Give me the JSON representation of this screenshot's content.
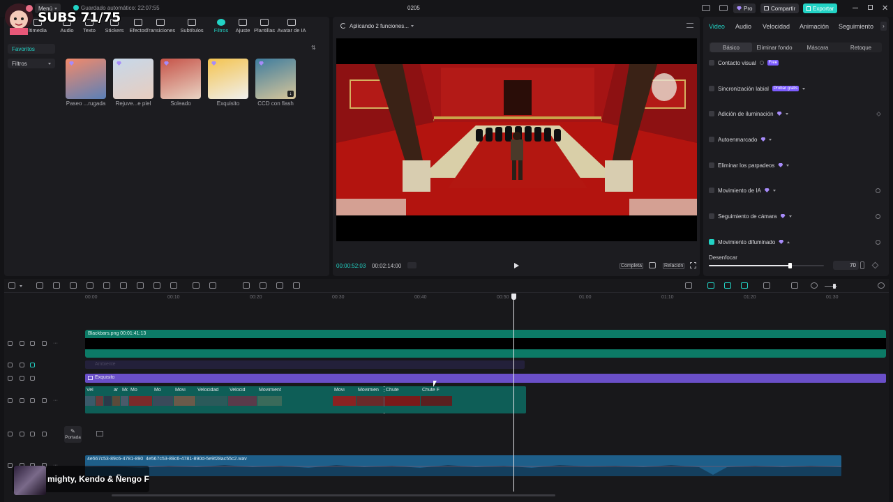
{
  "topbar": {
    "menu_label": "Menú",
    "autosave_label": "Guardado automático: 22:07:55",
    "project_title": "0205",
    "pro_label": "Pro",
    "share_label": "Compartir",
    "export_label": "Exportar"
  },
  "overlay": {
    "subs_text": "SUBS 71/75"
  },
  "toolbar": {
    "items": [
      {
        "label": "ltimedia",
        "icon": "media-icon"
      },
      {
        "label": "Audio",
        "icon": "audio-icon"
      },
      {
        "label": "Texto",
        "icon": "text-icon"
      },
      {
        "label": "Stickers",
        "icon": "sticker-icon"
      },
      {
        "label": "Efectos",
        "icon": "effects-icon"
      },
      {
        "label": "Transiciones",
        "icon": "transitions-icon"
      },
      {
        "label": "Subtítulos",
        "icon": "subtitles-icon"
      },
      {
        "label": "Filtros",
        "icon": "filters-icon"
      },
      {
        "label": "Ajuste",
        "icon": "adjust-icon"
      },
      {
        "label": "Plantillas",
        "icon": "templates-icon"
      },
      {
        "label": "Avatar de IA",
        "icon": "ai-avatar-icon"
      }
    ]
  },
  "sidebar": {
    "favorites": "Favoritos",
    "filters": "Filtros"
  },
  "filters": [
    {
      "label": "Paseo ...rugada",
      "colors": [
        "#f38a6a",
        "#5a80b8"
      ]
    },
    {
      "label": "Rejuve...e piel",
      "colors": [
        "#c6d8ea",
        "#e8cdbf"
      ]
    },
    {
      "label": "Soleado",
      "colors": [
        "#c65348",
        "#e9d4c4"
      ]
    },
    {
      "label": "Exquisito",
      "colors": [
        "#f4c34f",
        "#f0f0ee"
      ]
    },
    {
      "label": "CCD con flash",
      "colors": [
        "#3e7c9e",
        "#d8c69a"
      ]
    }
  ],
  "player": {
    "status": "Aplicando 2 funciones...",
    "current_time": "00:00:52:03",
    "total_time": "00:02:14:00",
    "full_label": "Completa",
    "ratio_label": "Relación"
  },
  "right_panel": {
    "tabs": [
      "Video",
      "Audio",
      "Velocidad",
      "Animación",
      "Seguimiento"
    ],
    "subtabs": [
      "Básico",
      "Eliminar fondo",
      "Máscara",
      "Retoque"
    ],
    "props": [
      {
        "label": "Contacto visual",
        "tag": "Free",
        "checked": false
      },
      {
        "label": "Sincronización labial",
        "tag": "Probar gratis",
        "checked": false
      },
      {
        "label": "Adición de iluminación",
        "tag": "",
        "checked": false
      },
      {
        "label": "Autoenmarcado",
        "tag": "",
        "checked": false
      },
      {
        "label": "Eliminar los parpadeos",
        "tag": "",
        "checked": false
      },
      {
        "label": "Movimiento de IA",
        "tag": "",
        "checked": false
      },
      {
        "label": "Seguimiento de cámara",
        "tag": "",
        "checked": false
      },
      {
        "label": "Movimiento difuminado",
        "tag": "",
        "checked": true
      }
    ],
    "blur_label": "Desenfocar",
    "blur_value": "70",
    "blur_fraction": 0.7
  },
  "timeline": {
    "ruler": [
      "00:00",
      "00:10",
      "00:20",
      "00:30",
      "00:40",
      "00:50",
      "01:00",
      "01:10",
      "01:20",
      "01:30"
    ],
    "overlay_clip_label": "Blackbars.png   00:01:41:13",
    "effect_clip_label": "Exquisito",
    "ghost_clip_label": "Ambiente",
    "cover_label": "Portada",
    "audio_label_a": "4e567c53-89c6-4781-890",
    "audio_label_b": "4e567c53-89c6-4781-890d-5e9f28ac55c2.wav",
    "video_clips": [
      "Vel",
      "",
      "",
      "ar",
      "Mov",
      "Mo",
      "Mo",
      "Movi",
      "Velocidad",
      "Velocid",
      "Movimiento difumi",
      "Movimiento difu",
      "Movi",
      "Movimien",
      "Chute",
      "Chute F"
    ],
    "music_overlay": "mighty, Kendo & Ñengo F"
  }
}
